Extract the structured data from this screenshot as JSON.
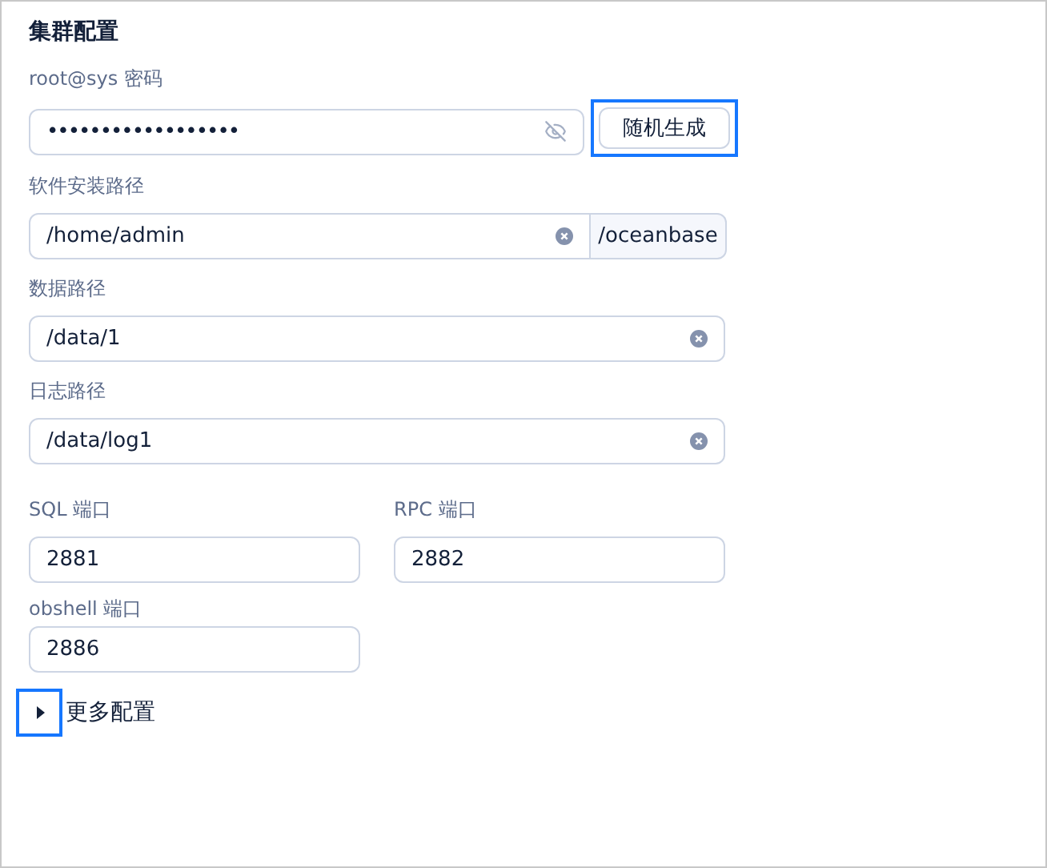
{
  "section_title": "集群配置",
  "fields": [
    {
      "kind": "password",
      "label": "root@sys 密码",
      "value": "••••••••••••••••••",
      "action": {
        "label": "随机生成",
        "focused": true
      }
    },
    {
      "kind": "addon",
      "label": "软件安装路径",
      "value": "/home/admin",
      "addon": "/oceanbase"
    },
    {
      "kind": "clearable",
      "label": "数据路径",
      "value": "/data/1"
    },
    {
      "kind": "clearable",
      "label": "日志路径",
      "value": "/data/log1"
    }
  ],
  "ports": [
    {
      "label": "SQL 端口",
      "value": "2881"
    },
    {
      "label": "RPC 端口",
      "value": "2882"
    },
    {
      "label": "obshell 端口",
      "value": "2886"
    }
  ],
  "more": {
    "label": "更多配置",
    "expanded": false,
    "focused": true
  }
}
